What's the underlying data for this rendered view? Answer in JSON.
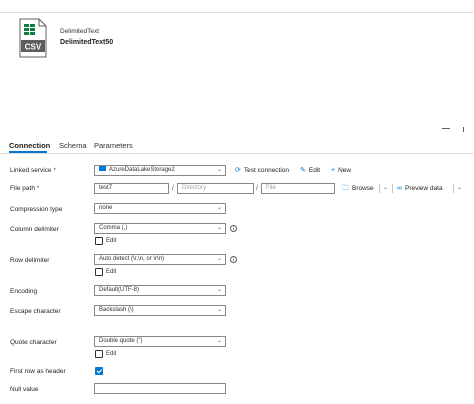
{
  "dataset": {
    "type_label": "DelimitedText",
    "name": "DelimitedText50",
    "icon_label": "CSV"
  },
  "tabs": [
    {
      "label": "Connection",
      "active": true
    },
    {
      "label": "Schema",
      "active": false
    },
    {
      "label": "Parameters",
      "active": false
    }
  ],
  "form": {
    "linked_service": {
      "label": "Linked service",
      "value": "AzureDataLakeStorage2",
      "test_connection": "Test connection",
      "edit": "Edit",
      "new": "New"
    },
    "file_path": {
      "label": "File path",
      "container": "test7",
      "directory_placeholder": "Directory",
      "file_placeholder": "File",
      "separator": "/",
      "browse": "Browse",
      "preview": "Preview data"
    },
    "compression_type": {
      "label": "Compression type",
      "value": "none"
    },
    "column_delimiter": {
      "label": "Column delimiter",
      "value": "Comma (,)",
      "edit_label": "Edit"
    },
    "row_delimiter": {
      "label": "Row delimiter",
      "value": "Auto detect (\\r,\\n, or \\r\\n)",
      "edit_label": "Edit"
    },
    "encoding": {
      "label": "Encoding",
      "value": "Default(UTF-8)"
    },
    "escape_character": {
      "label": "Escape character",
      "value": "Backslash (\\)"
    },
    "quote_character": {
      "label": "Quote character",
      "value": "Double quote (\")",
      "edit_label": "Edit"
    },
    "first_row_header": {
      "label": "First row as header",
      "checked": true
    },
    "null_value": {
      "label": "Null value",
      "value": ""
    }
  },
  "colors": {
    "accent": "#0078d4",
    "required": "#a4262c"
  },
  "icons": {
    "required_marker": "*",
    "info": "i"
  }
}
